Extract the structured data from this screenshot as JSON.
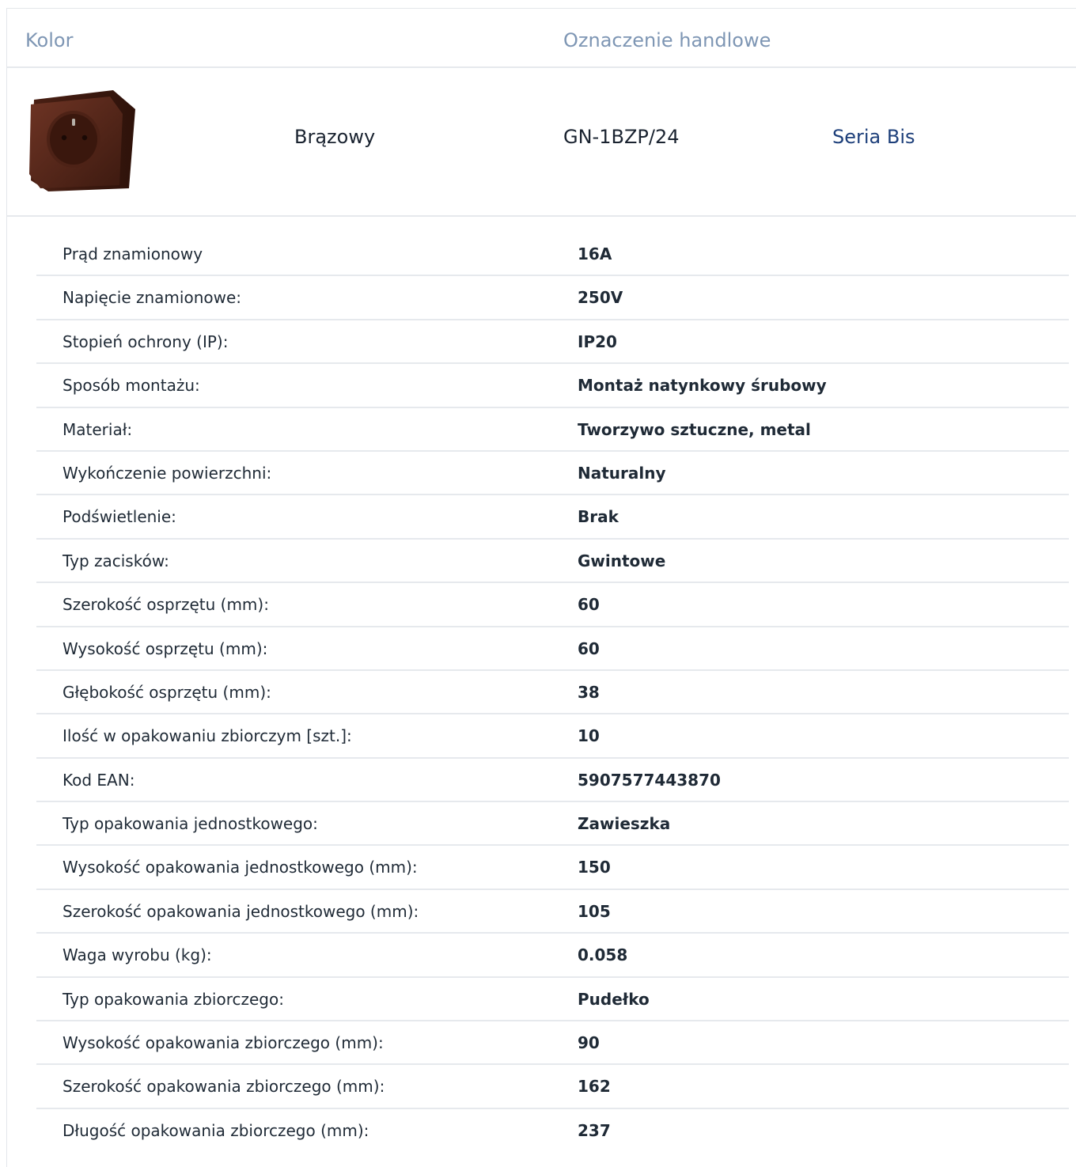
{
  "header": {
    "col_color": "Kolor",
    "col_trade": "Oznaczenie handlowe"
  },
  "product": {
    "image_icon": "socket-image",
    "color_name": "Brązowy",
    "code": "GN-1BZP/24",
    "series": "Seria Bis",
    "series_link_color": "#1d3f7a",
    "socket_color": "#5a2b1e"
  },
  "specs": [
    {
      "label": "Prąd znamionowy",
      "value": "16A"
    },
    {
      "label": "Napięcie znamionowe:",
      "value": "250V"
    },
    {
      "label": "Stopień ochrony (IP):",
      "value": "IP20"
    },
    {
      "label": "Sposób montażu:",
      "value": "Montaż natynkowy śrubowy"
    },
    {
      "label": "Materiał:",
      "value": "Tworzywo sztuczne, metal"
    },
    {
      "label": "Wykończenie powierzchni:",
      "value": "Naturalny"
    },
    {
      "label": "Podświetlenie:",
      "value": "Brak"
    },
    {
      "label": "Typ zacisków:",
      "value": "Gwintowe"
    },
    {
      "label": "Szerokość osprzętu (mm):",
      "value": "60"
    },
    {
      "label": "Wysokość osprzętu (mm):",
      "value": "60"
    },
    {
      "label": "Głębokość osprzętu (mm):",
      "value": "38"
    },
    {
      "label": "Ilość w opakowaniu zbiorczym [szt.]:",
      "value": "10"
    },
    {
      "label": "Kod EAN:",
      "value": "5907577443870"
    },
    {
      "label": "Typ opakowania jednostkowego:",
      "value": "Zawieszka"
    },
    {
      "label": "Wysokość opakowania jednostkowego (mm):",
      "value": "150"
    },
    {
      "label": "Szerokość opakowania jednostkowego (mm):",
      "value": "105"
    },
    {
      "label": "Waga wyrobu (kg):",
      "value": "0.058"
    },
    {
      "label": "Typ opakowania zbiorczego:",
      "value": "Pudełko"
    },
    {
      "label": "Wysokość opakowania zbiorczego (mm):",
      "value": "90"
    },
    {
      "label": "Szerokość opakowania zbiorczego (mm):",
      "value": "162"
    },
    {
      "label": "Długość opakowania zbiorczego (mm):",
      "value": "237"
    }
  ]
}
